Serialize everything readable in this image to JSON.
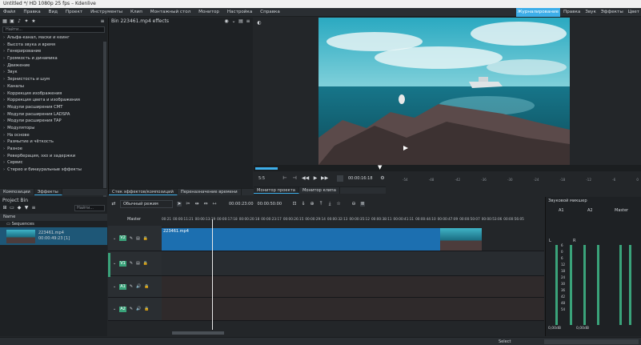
{
  "window": {
    "title": "Untitled */ HD 1080p 25 fps – Kdenlive"
  },
  "menu": {
    "items": [
      "Файл",
      "Правка",
      "Вид",
      "Проект",
      "Инструменты",
      "Клип",
      "Монтажный стол",
      "Монитор",
      "Настройка",
      "Справка"
    ],
    "workspaces": [
      "Журналирование",
      "Правка",
      "Звук",
      "Эффекты",
      "Цвет"
    ],
    "active_workspace": "Журналирование"
  },
  "effects": {
    "search_placeholder": "Найти...",
    "categories": [
      "Альфа-канал, маски и кеинг",
      "Высота звука и время",
      "Генерирование",
      "Громкость и динамика",
      "Движение",
      "Звук",
      "Зернистость и шум",
      "Каналы",
      "Коррекция изображения",
      "Коррекция цвета и изображения",
      "Модули расширения CMT",
      "Модули расширения LADSPA",
      "Модули расширения TAP",
      "Модуляторы",
      "На основе",
      "Размытие и чёткость",
      "Разное",
      "Реверберация, эхо и задержки",
      "Сервис",
      "Стерео и бинауральные эффекты"
    ],
    "tabs": [
      "Композиции",
      "Эффекты"
    ]
  },
  "bin_effects": {
    "title": "Bin 223461.mp4 effects",
    "tabs": [
      "Стек эффектов/композиций",
      "Переназначение времени"
    ]
  },
  "monitor": {
    "zoom": "5:5",
    "timecode": "00:00:16:18",
    "tabs": [
      "Монитор проекта",
      "Монитор клипа"
    ],
    "scale": [
      "-54",
      "-48",
      "-42",
      "-36",
      "-30",
      "-24",
      "-18",
      "-12",
      "-6",
      "0"
    ]
  },
  "project_bin": {
    "title": "Project Bin",
    "search_placeholder": "Найти...",
    "column": "Name",
    "folder": "Sequences",
    "clip_name": "223461.mp4",
    "clip_duration": "00:00:49:23 [1]"
  },
  "timeline": {
    "mode": "Обычный режим",
    "position": "00:00:23:00",
    "duration": "00:00:50:00",
    "master": "Master",
    "ruler": [
      "00:21",
      "00:00:11:21",
      "00:00:13:19",
      "00:00:17:18",
      "00:00:20:18",
      "00:00:23:17",
      "00:00:26:15",
      "00:00:29:14",
      "00:00:32:13",
      "00:00:35:12",
      "00:00:38:11",
      "00:00:41:11",
      "00:00:44:10",
      "00:00:47:09",
      "00:00:50:07",
      "00:00:53:06",
      "00:00:56:05"
    ],
    "tracks": [
      {
        "badge": "V2",
        "label": "223461.mp4"
      },
      {
        "badge": "V1"
      },
      {
        "badge": "A1"
      },
      {
        "badge": "A2"
      }
    ]
  },
  "mixer": {
    "title": "Звуковой микшер",
    "channels": [
      "A1",
      "A2",
      "Master"
    ],
    "db_a1": "0,00dB",
    "db_a2": "0,00dB",
    "scale": [
      "6",
      "0",
      "6",
      "12",
      "18",
      "24",
      "30",
      "36",
      "42",
      "48",
      "54"
    ],
    "lr": [
      "L",
      "R"
    ]
  },
  "status": {
    "select": "Select"
  }
}
